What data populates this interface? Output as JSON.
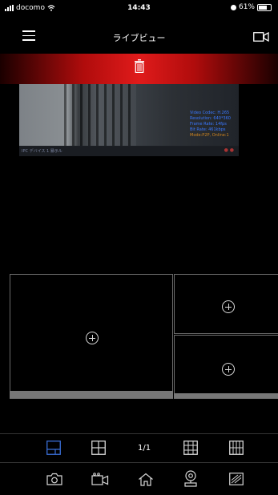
{
  "status_bar": {
    "carrier": "docomo",
    "time": "14:43",
    "battery": "61%",
    "battery_level": 0.61
  },
  "header": {
    "title": "ライブビュー"
  },
  "video": {
    "info_lines": [
      "Video Codec: H.265",
      "Resolution: 640*360",
      "Frame Rate: 14fps",
      "Bit Rate: 461kbps"
    ],
    "mode_line": "Mode:P2P, Online:1",
    "caption": "IPC デバイス 1 暴示ル"
  },
  "layout_toolbar": {
    "page_indicator": "1/1"
  },
  "colors": {
    "delete_bar": "#e01b1b",
    "accent": "#3a6fd8",
    "icon": "#d8d8d8"
  },
  "icons": {
    "header": [
      "menu-icon",
      "camera-icon"
    ],
    "delete_bar": "trash-icon",
    "layout_toolbar": [
      "single-layout-icon",
      "quad-layout-icon",
      "grid-layout-icon",
      "multi-grid-layout-icon"
    ],
    "bottom_nav": [
      "snapshot-icon",
      "record-icon",
      "home-icon",
      "ptz-icon",
      "fullscreen-icon"
    ]
  }
}
